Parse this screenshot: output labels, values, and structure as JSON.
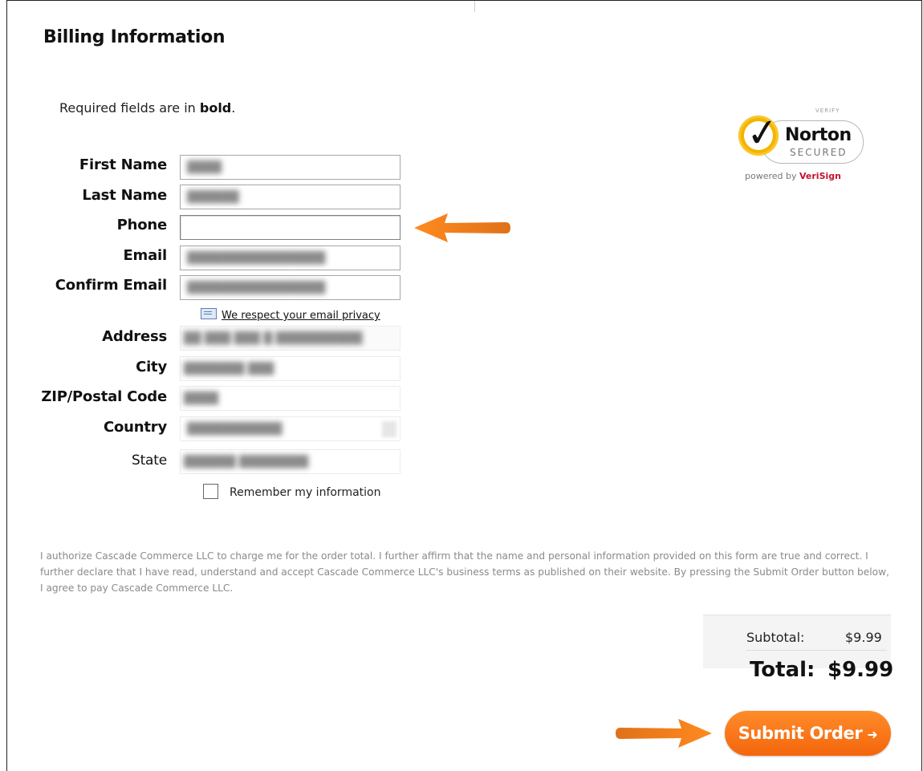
{
  "page": {
    "title": "Billing Information",
    "required_prefix": "Required fields are in ",
    "required_bold": "bold",
    "required_suffix": "."
  },
  "badge": {
    "verify": "VERIFY",
    "brand": "Norton",
    "secured": "SECURED",
    "powered_prefix": "powered by ",
    "powered_brand": "VeriSign"
  },
  "form": {
    "first_name_label": "First Name",
    "last_name_label": "Last Name",
    "phone_label": "Phone",
    "email_label": "Email",
    "confirm_email_label": "Confirm Email",
    "privacy_link": "We respect your email privacy",
    "address_label": "Address",
    "city_label": "City",
    "zip_label": "ZIP/Postal Code",
    "country_label": "Country",
    "state_label": "State",
    "remember_label": "Remember my information"
  },
  "legal": {
    "text": "I authorize Cascade Commerce LLC to charge me for the order total. I further affirm that the name and personal information provided on this form are true and correct. I further declare that I have read, understand and accept Cascade Commerce LLC's business terms as published on their website. By pressing the Submit Order button below, I agree to pay Cascade Commerce LLC."
  },
  "totals": {
    "subtotal_label": "Subtotal:",
    "subtotal_value": "$9.99",
    "total_label": "Total:",
    "total_value": "$9.99"
  },
  "actions": {
    "submit_label": "Submit Order",
    "submit_icon": "➜"
  },
  "colors": {
    "accent": "#f4650c",
    "arrow": "#f07f1d"
  }
}
